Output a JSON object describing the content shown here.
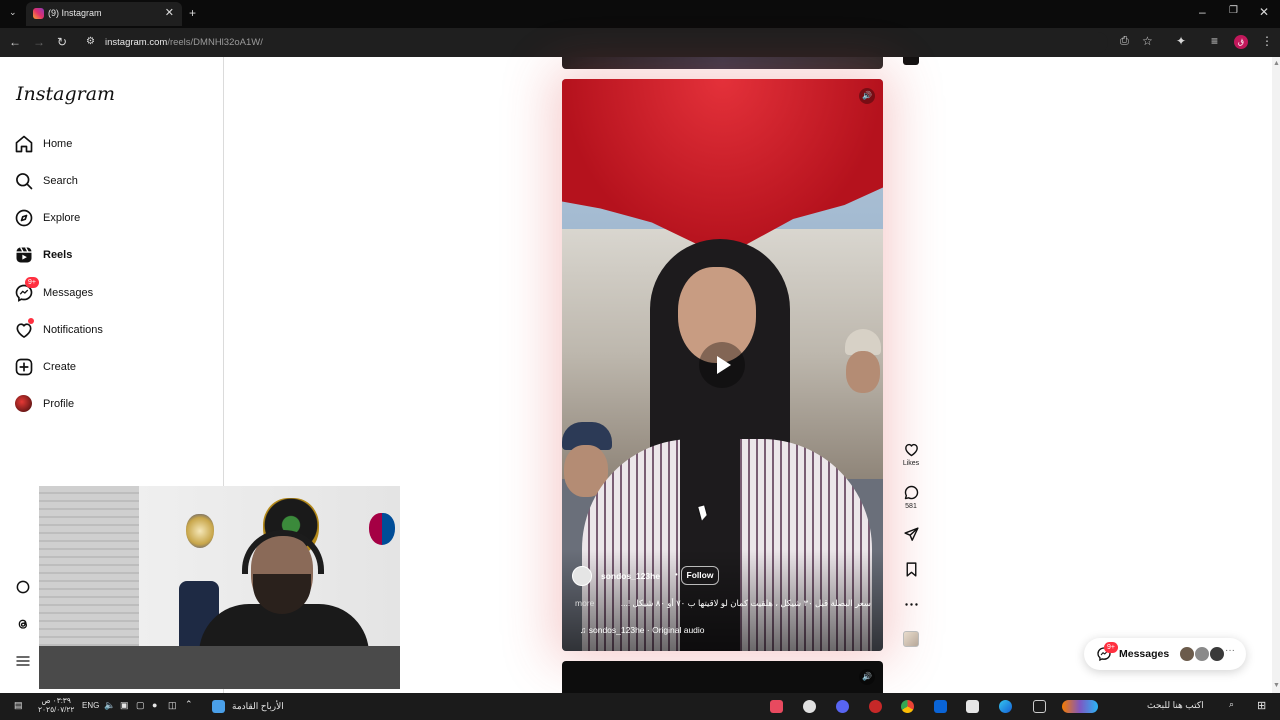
{
  "browser": {
    "tab_title": "(9) Instagram",
    "url_host": "instagram.com",
    "url_path": "/reels/DMNHl32oA1W/",
    "profile_initial": "ق"
  },
  "sidebar": {
    "logo": "Instagram",
    "items": [
      {
        "label": "Home"
      },
      {
        "label": "Search"
      },
      {
        "label": "Explore"
      },
      {
        "label": "Reels"
      },
      {
        "label": "Messages",
        "badge": "9+"
      },
      {
        "label": "Notifications"
      },
      {
        "label": "Create"
      },
      {
        "label": "Profile"
      }
    ]
  },
  "reel": {
    "author": "sondos_123he",
    "separator": "•",
    "follow_label": "Follow",
    "caption": "سعر البصلة قبل ٣٠ شيكل ، هلقيت كمان لو لاقيتها ب ٧٠ أو ٨٠ شيكل !...",
    "more_label": "more",
    "audio": "sondos_123he · Original audio"
  },
  "rail": {
    "likes_label": "Likes",
    "comments_count": "581"
  },
  "messages_pill": {
    "label": "Messages",
    "badge": "9+"
  },
  "taskbar": {
    "search_placeholder": "اكتب هنا للبحث",
    "pinned_doc": "الأرباح القادمة",
    "lang": "ENG",
    "time": "٠٣:٣٩ ص",
    "date": "٢٠٢٥/٠٧/٢٢"
  },
  "colors": {
    "brand_badge": "#ff3040",
    "taskbar_bg": "#1b1b1b",
    "chrome_bg": "#1f1f1f"
  }
}
